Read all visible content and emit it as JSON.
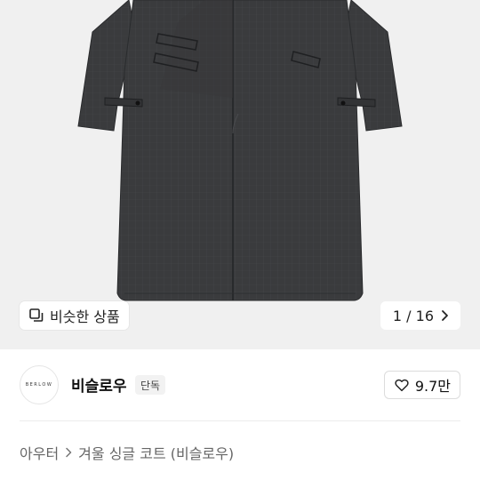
{
  "hero": {
    "image_alt": "coat-product-photo",
    "similar_label": "비슷한 상품",
    "pager": {
      "current": "1",
      "separator": "/",
      "total": "16",
      "text": "1 / 16"
    }
  },
  "seller": {
    "avatar_logo_text": "BERLOW",
    "name": "비슬로우",
    "badge": "단독",
    "like_count": "9.7만"
  },
  "breadcrumb": {
    "category": "아우터",
    "product": "겨울 싱글 코트 (비슬로우)"
  },
  "colors": {
    "hero_bg": "#f0f0f0",
    "coat": "#3a3b3d"
  },
  "icons": {
    "similar": "similar-items-icon",
    "pager_next": "chevron-right-icon",
    "like": "heart-outline-icon",
    "breadcrumb_sep": "chevron-right-icon"
  }
}
